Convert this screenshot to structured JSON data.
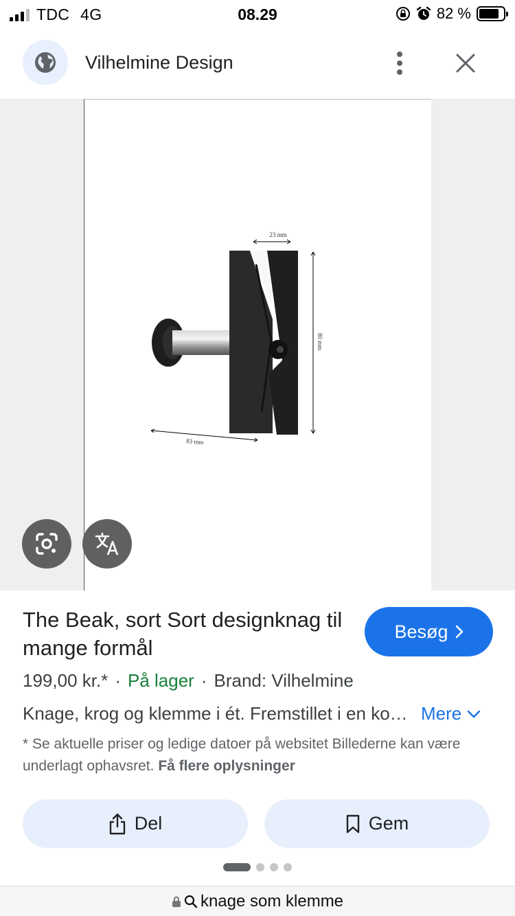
{
  "status_bar": {
    "carrier": "TDC",
    "network": "4G",
    "time": "08.29",
    "battery_percent": "82 %",
    "battery_level": 0.82
  },
  "header": {
    "site_name": "Vilhelmine Design",
    "site_icon": "globe-icon",
    "menu_icon": "more-vert-icon",
    "close_icon": "close-icon"
  },
  "image": {
    "dim_top": "23 mm",
    "dim_side": "80 mm",
    "dim_bottom": "83 mm"
  },
  "overlay_buttons": {
    "lens_icon": "lens-search-icon",
    "translate_icon": "translate-icon"
  },
  "product": {
    "title": "The Beak, sort Sort designknag til mange formål",
    "price": "199,00 kr.*",
    "stock": "På lager",
    "brand": "Brand: Vilhelmine",
    "description": "Knage, krog og klemme i ét. Fremstillet i en kombination af stål og sort materiale",
    "more_label": "Mere",
    "disclaimer": "* Se aktuelle priser og ledige datoer på websitet Billederne kan være underlagt ophavsret.",
    "more_info_label": "Få flere oplysninger"
  },
  "visit_button": {
    "label": "Besøg"
  },
  "actions": {
    "share_label": "Del",
    "save_label": "Gem"
  },
  "pagination": {
    "current": 1,
    "total": 4
  },
  "address_bar": {
    "query": "knage som klemme"
  },
  "colors": {
    "accent": "#1a73e8",
    "stock_green": "#188038",
    "action_bg": "#e8effc"
  }
}
